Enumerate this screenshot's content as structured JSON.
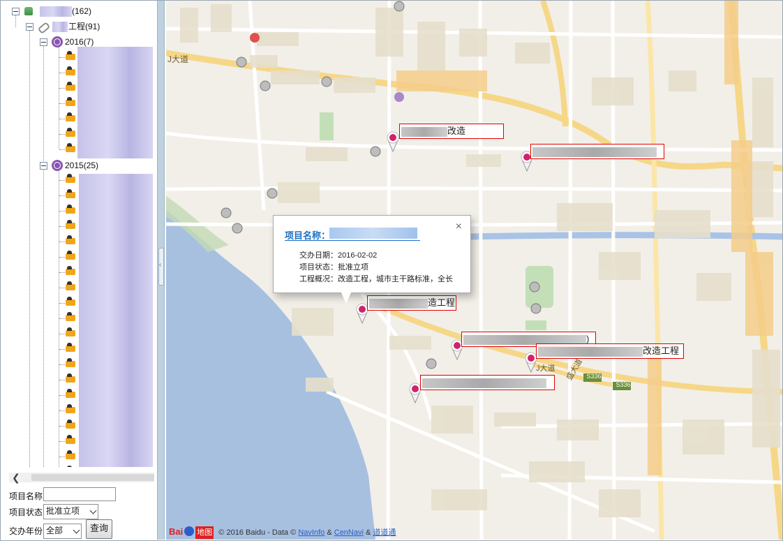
{
  "tree": {
    "root": {
      "count_label": "(162)"
    },
    "group": {
      "label": "工程(91)"
    },
    "years": [
      {
        "label": "2016(7)"
      },
      {
        "label": "2015(25)"
      }
    ]
  },
  "search_form": {
    "name_label": "项目名称",
    "name_value": "",
    "status_label": "项目状态",
    "status_value": "批准立项",
    "year_label": "交办年份",
    "year_value": "全部",
    "query_button": "查询"
  },
  "map": {
    "popup": {
      "title_label": "项目名称：",
      "close_glyph": "×",
      "date_line": "交办日期：2016-02-02",
      "status_line": "项目状态：批准立项",
      "overview_line": "工程概况：改造工程，城市主干路标准，全长"
    },
    "markers": [
      {
        "suffix": "改造"
      },
      {
        "suffix": ""
      },
      {
        "suffix": "造工程"
      },
      {
        "suffix": ")"
      },
      {
        "suffix": "改造工程"
      },
      {
        "suffix": ""
      }
    ],
    "road_labels": {
      "left_top": "J大道",
      "middle": "J大道",
      "diag": "盛大道",
      "s336a": "S336",
      "s336b": "S336"
    },
    "attribution": {
      "brand": "Bai",
      "brand_suffix": "地图",
      "text": "© 2016 Baidu - Data ©",
      "link1": "NavInfo",
      "amp1": "&",
      "link2": "CenNavi",
      "amp2": "&",
      "link3": "道道通"
    }
  }
}
